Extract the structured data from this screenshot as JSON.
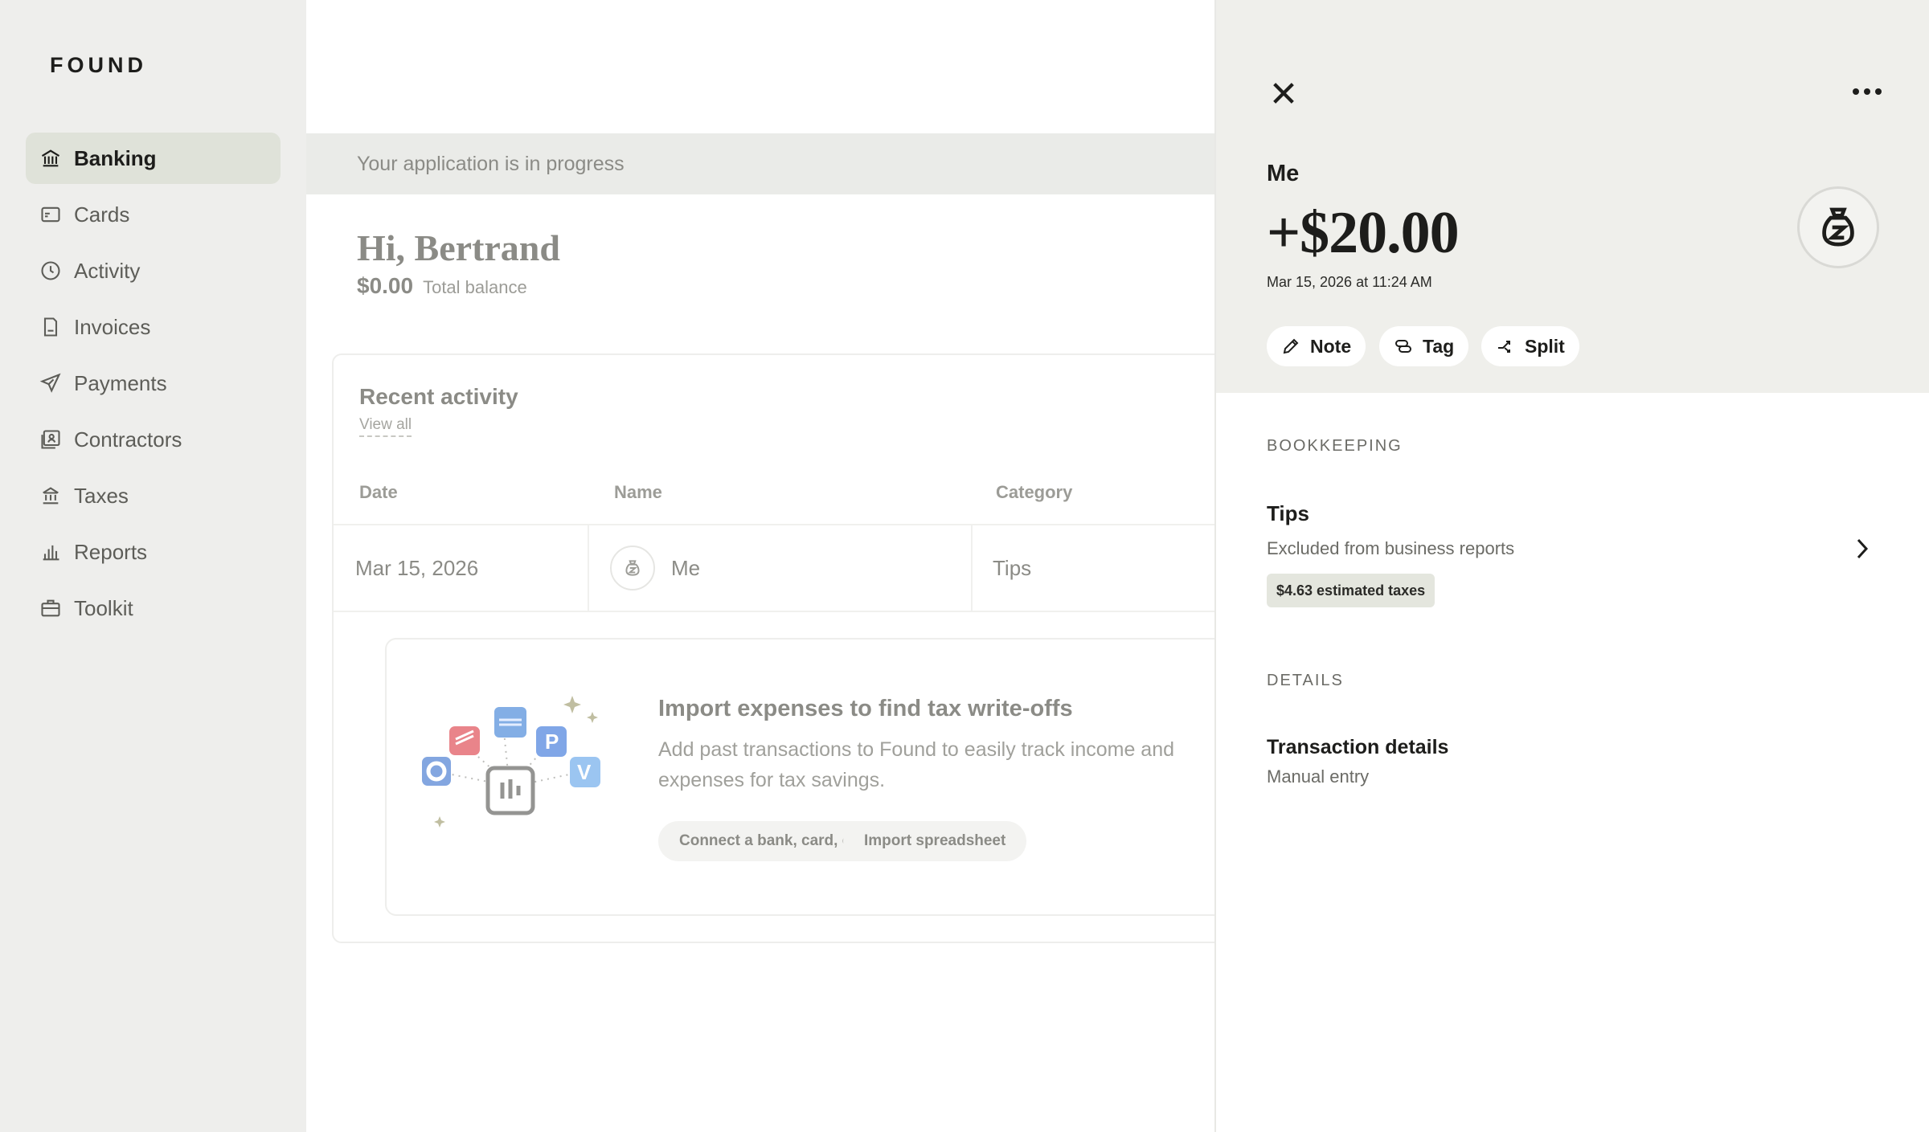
{
  "brand": {
    "logo": "FOUND"
  },
  "sidebar": {
    "items": [
      {
        "label": "Banking",
        "icon": "bank-icon",
        "active": true
      },
      {
        "label": "Cards",
        "icon": "card-icon"
      },
      {
        "label": "Activity",
        "icon": "clock-icon"
      },
      {
        "label": "Invoices",
        "icon": "invoice-icon"
      },
      {
        "label": "Payments",
        "icon": "send-icon"
      },
      {
        "label": "Contractors",
        "icon": "contractor-icon"
      },
      {
        "label": "Taxes",
        "icon": "government-icon"
      },
      {
        "label": "Reports",
        "icon": "bar-chart-icon"
      },
      {
        "label": "Toolkit",
        "icon": "briefcase-icon"
      }
    ]
  },
  "main": {
    "banner": "Your application is in progress",
    "greeting": "Hi, Bertrand",
    "balance": {
      "amount": "$0.00",
      "label": "Total balance"
    },
    "recent_activity": {
      "title": "Recent activity",
      "view_all": "View all",
      "columns": [
        "Date",
        "Name",
        "Category"
      ],
      "rows": [
        {
          "date": "Mar 15, 2026",
          "name": "Me",
          "category": "Tips"
        }
      ]
    },
    "import": {
      "title": "Import expenses to find tax write-offs",
      "description": "Add past transactions to Found to easily track income and expenses for tax savings.",
      "connect_label": "Connect a bank, card, or app",
      "spreadsheet_label": "Import spreadsheet"
    }
  },
  "panel": {
    "payee": "Me",
    "amount": "+$20.00",
    "date": "Mar 15, 2026 at 11:24 AM",
    "actions": {
      "note": "Note",
      "tag": "Tag",
      "split": "Split"
    },
    "bookkeeping": {
      "section": "BOOKKEEPING",
      "category": "Tips",
      "subtitle": "Excluded from business reports",
      "badge": "$4.63 estimated taxes"
    },
    "details": {
      "section": "DETAILS",
      "title": "Transaction details",
      "subtitle": "Manual entry"
    }
  },
  "colors": {
    "sidebar_bg": "#eeeeec",
    "active_nav_bg": "#dfe2d9",
    "panel_header_bg": "#efefeb",
    "badge_bg": "#e4e6de"
  }
}
